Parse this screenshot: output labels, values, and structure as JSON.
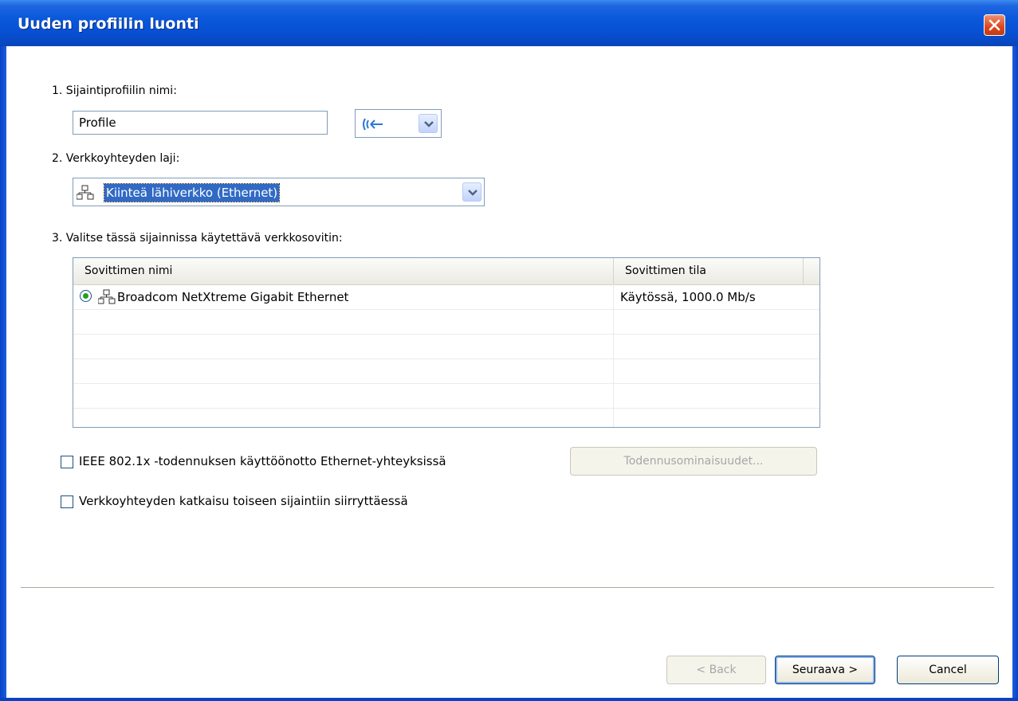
{
  "window": {
    "title": "Uuden profiilin luonti"
  },
  "step1": {
    "label": "1. Sijaintiprofiilin nimi:",
    "value": "Profile",
    "icon_picker": "wireless-signal-icon"
  },
  "step2": {
    "label": "2. Verkkoyhteyden laji:",
    "selected": "Kiinteä lähiverkko (Ethernet)"
  },
  "step3": {
    "label": "3. Valitse tässä sijainnissa käytettävä verkkosovitin:",
    "columns": [
      "Sovittimen nimi",
      "Sovittimen tila"
    ],
    "rows": [
      {
        "name": "Broadcom NetXtreme Gigabit Ethernet",
        "status": "Käytössä, 1000.0 Mb/s",
        "selected": true
      }
    ]
  },
  "options": {
    "ieee_label": "IEEE 802.1x -todennuksen käyttöönotto Ethernet-yhteyksissä",
    "auth_button": "Todennusominaisuudet...",
    "disconnect_label": "Verkkoyhteyden katkaisu toiseen sijaintiin siirryttäessä"
  },
  "footer": {
    "back": "< Back",
    "next": "Seuraava >",
    "cancel": "Cancel"
  },
  "colors": {
    "titlebar": "#0a58db",
    "selection": "#316ac5"
  }
}
